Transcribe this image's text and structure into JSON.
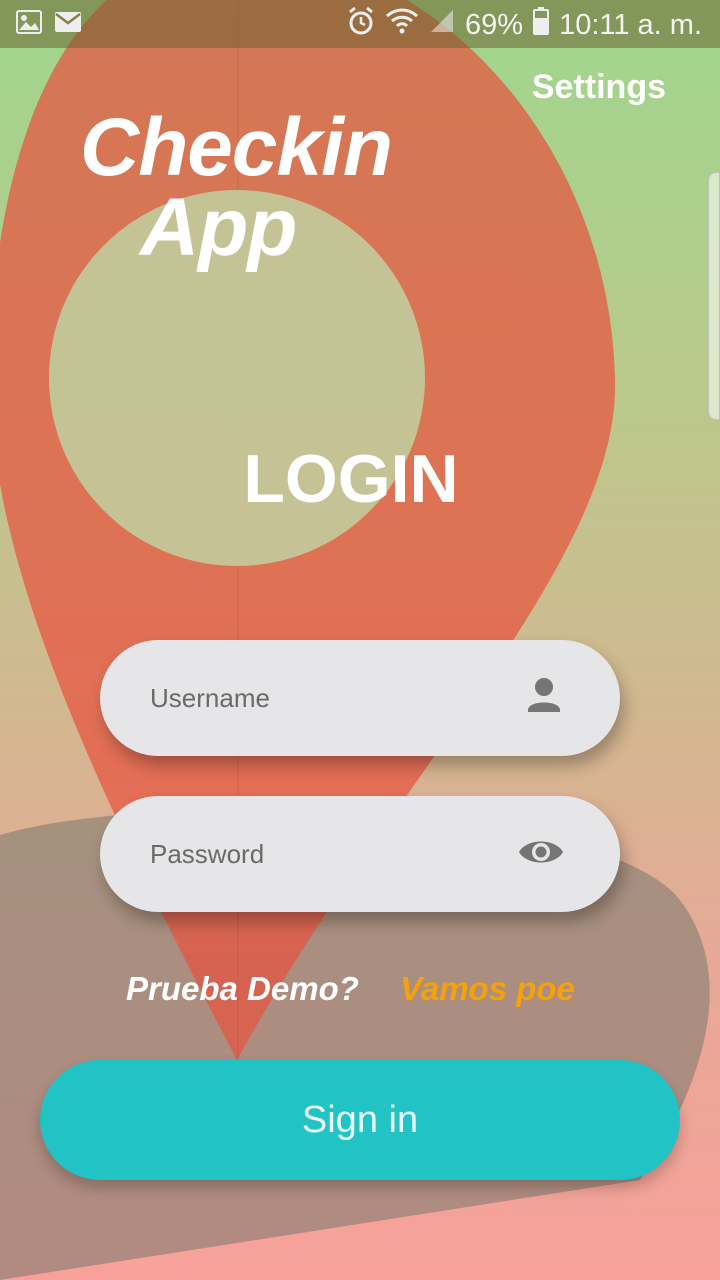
{
  "status_bar": {
    "notification_icons": [
      "image-icon",
      "mail-icon"
    ],
    "alarm_icon": "alarm-icon",
    "wifi_icon": "wifi-icon",
    "signal_icon": "signal-icon",
    "battery_percent": "69%",
    "battery_icon": "battery-icon",
    "time": "10:11 a. m."
  },
  "header": {
    "settings_label": "Settings",
    "app_title_line1": "Checkin",
    "app_title_line2": "App"
  },
  "login": {
    "title": "LOGIN",
    "username_placeholder": "Username",
    "username_icon": "person-icon",
    "password_placeholder": "Password",
    "password_icon": "eye-icon",
    "demo_question": "Prueba Demo?",
    "demo_link": "Vamos poe",
    "signin_label": "Sign in"
  },
  "colors": {
    "accent_button": "#22c3c4",
    "demo_link": "#f5a20a",
    "pin_red": "#e8533e"
  }
}
